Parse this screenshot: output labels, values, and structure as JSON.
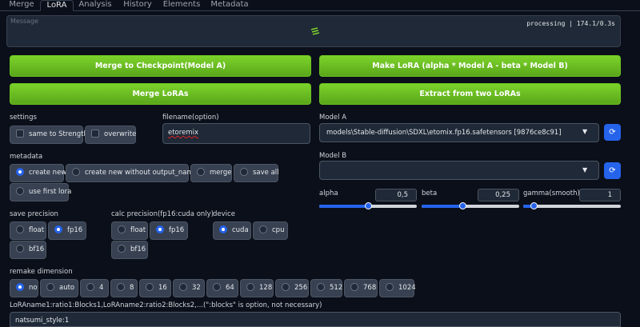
{
  "tabs": [
    {
      "label": "Merge"
    },
    {
      "label": "LoRA"
    },
    {
      "label": "Analysis"
    },
    {
      "label": "History"
    },
    {
      "label": "Elements"
    },
    {
      "label": "Metadata"
    }
  ],
  "active_tab": "LoRA",
  "message": {
    "label": "Message",
    "status": "processing | 174.1/0.3s"
  },
  "buttons": {
    "merge_checkpoint": "Merge to Checkpoint(Model A)",
    "make_lora": "Make LoRA (alpha * Model A - beta * Model B)",
    "merge_loras": "Merge LoRAs",
    "extract": "Extract from two LoRAs"
  },
  "settings": {
    "label": "settings",
    "options": [
      {
        "label": "same to Strength",
        "checked": false
      },
      {
        "label": "overwrite",
        "checked": false
      }
    ]
  },
  "filename": {
    "label": "filename(option)",
    "value": "etoremix"
  },
  "model_a": {
    "label": "Model A",
    "value": "models\\Stable-diffusion\\SDXL\\etomix.fp16.safetensors [9876ce8c91]"
  },
  "model_b": {
    "label": "Model B",
    "value": ""
  },
  "metadata": {
    "label": "metadata",
    "options": [
      {
        "label": "create new",
        "selected": true
      },
      {
        "label": "create new without output_name",
        "selected": false
      },
      {
        "label": "merge",
        "selected": false
      },
      {
        "label": "save all",
        "selected": false
      },
      {
        "label": "use first lora",
        "selected": false
      }
    ]
  },
  "sliders": {
    "alpha": {
      "label": "alpha",
      "value": "0,5",
      "fraction": 0.5
    },
    "beta": {
      "label": "beta",
      "value": "0,25",
      "fraction": 0.42
    },
    "gamma": {
      "label": "gamma(smooth)",
      "value": "1",
      "fraction": 0.11
    }
  },
  "save_precision": {
    "label": "save precision",
    "options": [
      {
        "label": "float",
        "selected": false
      },
      {
        "label": "fp16",
        "selected": true
      },
      {
        "label": "bf16",
        "selected": false
      }
    ]
  },
  "calc_precision": {
    "label": "calc precision(fp16:cuda only)",
    "options": [
      {
        "label": "float",
        "selected": false
      },
      {
        "label": "fp16",
        "selected": true
      },
      {
        "label": "bf16",
        "selected": false
      }
    ]
  },
  "device": {
    "label": "device",
    "options": [
      {
        "label": "cuda",
        "selected": true
      },
      {
        "label": "cpu",
        "selected": false
      }
    ]
  },
  "remake_dimension": {
    "label": "remake dimension",
    "options": [
      {
        "label": "no",
        "selected": true
      },
      {
        "label": "auto",
        "selected": false
      },
      {
        "label": "4",
        "selected": false
      },
      {
        "label": "8",
        "selected": false
      },
      {
        "label": "16",
        "selected": false
      },
      {
        "label": "32",
        "selected": false
      },
      {
        "label": "64",
        "selected": false
      },
      {
        "label": "128",
        "selected": false
      },
      {
        "label": "256",
        "selected": false
      },
      {
        "label": "512",
        "selected": false
      },
      {
        "label": "768",
        "selected": false
      },
      {
        "label": "1024",
        "selected": false
      }
    ]
  },
  "lora_names": {
    "label": "LoRAname1:ratio1:Blocks1,LoRAname2:ratio2:Blocks2,...(\":blocks\" is option, not necessary)",
    "value": "natsumi_style:1"
  },
  "icons": {
    "refresh": "refresh-icon",
    "dropdown": "chevron-down-icon",
    "loading": "loading-icon"
  },
  "colors": {
    "accent": "#2563eb",
    "button_green": "#6bc21f",
    "background": "#0b0f19"
  }
}
